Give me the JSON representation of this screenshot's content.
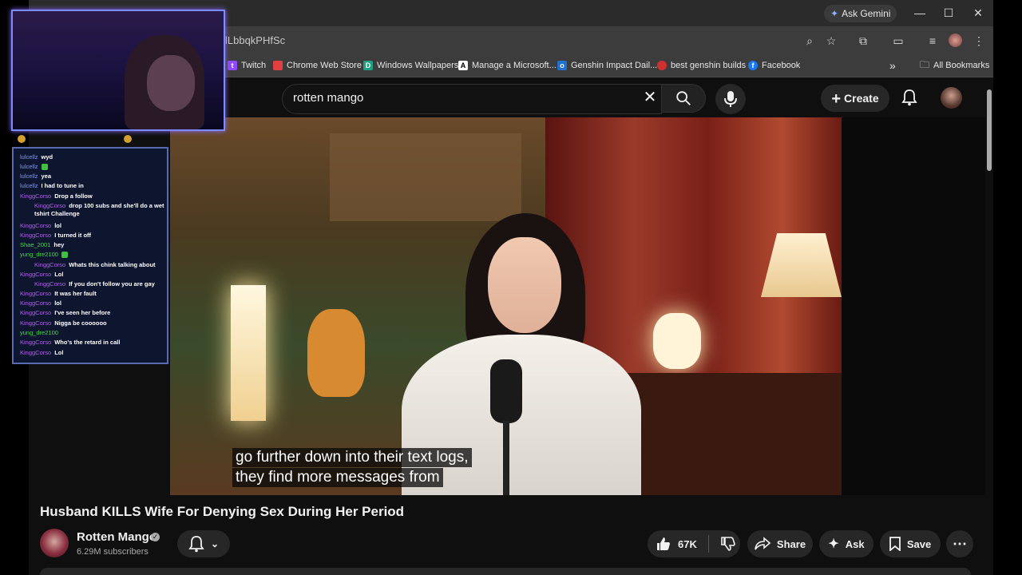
{
  "browser": {
    "url_fragment": "lLbbqkPHfSc",
    "ask_gemini": "Ask Gemini",
    "bookmarks": [
      {
        "label": "Twitch",
        "color": "#9146ff",
        "glyph": "t"
      },
      {
        "label": "Chrome Web Store",
        "color": "#e04040",
        "glyph": "■"
      },
      {
        "label": "Windows Wallpapers",
        "color": "#20a080",
        "glyph": "D"
      },
      {
        "label": "Manage a Microsoft...",
        "color": "#ffffff",
        "glyph": "A"
      },
      {
        "label": "Genshin Impact Dail...",
        "color": "#2070d0",
        "glyph": "o"
      },
      {
        "label": "best genshin builds",
        "color": "#d03030",
        "glyph": "●"
      },
      {
        "label": "Facebook",
        "color": "#1877f2",
        "glyph": "f"
      }
    ],
    "all_bookmarks": "All Bookmarks",
    "more_bookmarks": "»"
  },
  "youtube": {
    "search_value": "rotten mango",
    "create_label": "Create",
    "video": {
      "caption_line1": "go further down into their text logs,",
      "caption_line2": "they find more messages from"
    },
    "title": "Husband KILLS Wife For Denying Sex During Her Period",
    "channel": {
      "name": "Rotten Mango",
      "subscribers": "6.29M subscribers"
    },
    "actions": {
      "likes": "67K",
      "share": "Share",
      "ask": "Ask",
      "save": "Save"
    }
  },
  "stream_chat": [
    {
      "user": "lulcellz",
      "msg": "wyd",
      "cls": "lu"
    },
    {
      "user": "lulcellz",
      "msg": "",
      "cls": "lu",
      "emote": true
    },
    {
      "user": "lulcellz",
      "msg": "yea",
      "cls": "lu"
    },
    {
      "user": "lulcellz",
      "msg": "I had to tune in",
      "cls": "lu"
    },
    {
      "user": "KinggCorso",
      "msg": "Drop a follow",
      "cls": ""
    },
    {
      "user": "KinggCorso",
      "msg": "drop 100 subs and she'll do a wet tshirt Challenge",
      "cls": "",
      "indent": true
    },
    {
      "user": "KinggCorso",
      "msg": "lol",
      "cls": ""
    },
    {
      "user": "KinggCorso",
      "msg": "I turned it off",
      "cls": ""
    },
    {
      "user": "Shae_2001",
      "msg": "hey",
      "cls": "gr"
    },
    {
      "user": "yung_dre2100",
      "msg": "",
      "cls": "gr",
      "emote": true
    },
    {
      "user": "KinggCorso",
      "msg": "Whats this chink talking about",
      "cls": "",
      "indent": true
    },
    {
      "user": "KinggCorso",
      "msg": "Lol",
      "cls": ""
    },
    {
      "user": "KinggCorso",
      "msg": "If you don't follow you are gay",
      "cls": "",
      "indent": true
    },
    {
      "user": "KinggCorso",
      "msg": "It was her fault",
      "cls": ""
    },
    {
      "user": "KinggCorso",
      "msg": "lol",
      "cls": ""
    },
    {
      "user": "KinggCorso",
      "msg": "I've seen her before",
      "cls": ""
    },
    {
      "user": "KinggCorso",
      "msg": "Nigga be coooooo",
      "cls": ""
    },
    {
      "user": "yung_dre2100",
      "msg": "",
      "cls": "gr"
    },
    {
      "user": "KinggCorso",
      "msg": "Who's the retard in call",
      "cls": ""
    },
    {
      "user": "KinggCorso",
      "msg": "Lol",
      "cls": ""
    }
  ]
}
